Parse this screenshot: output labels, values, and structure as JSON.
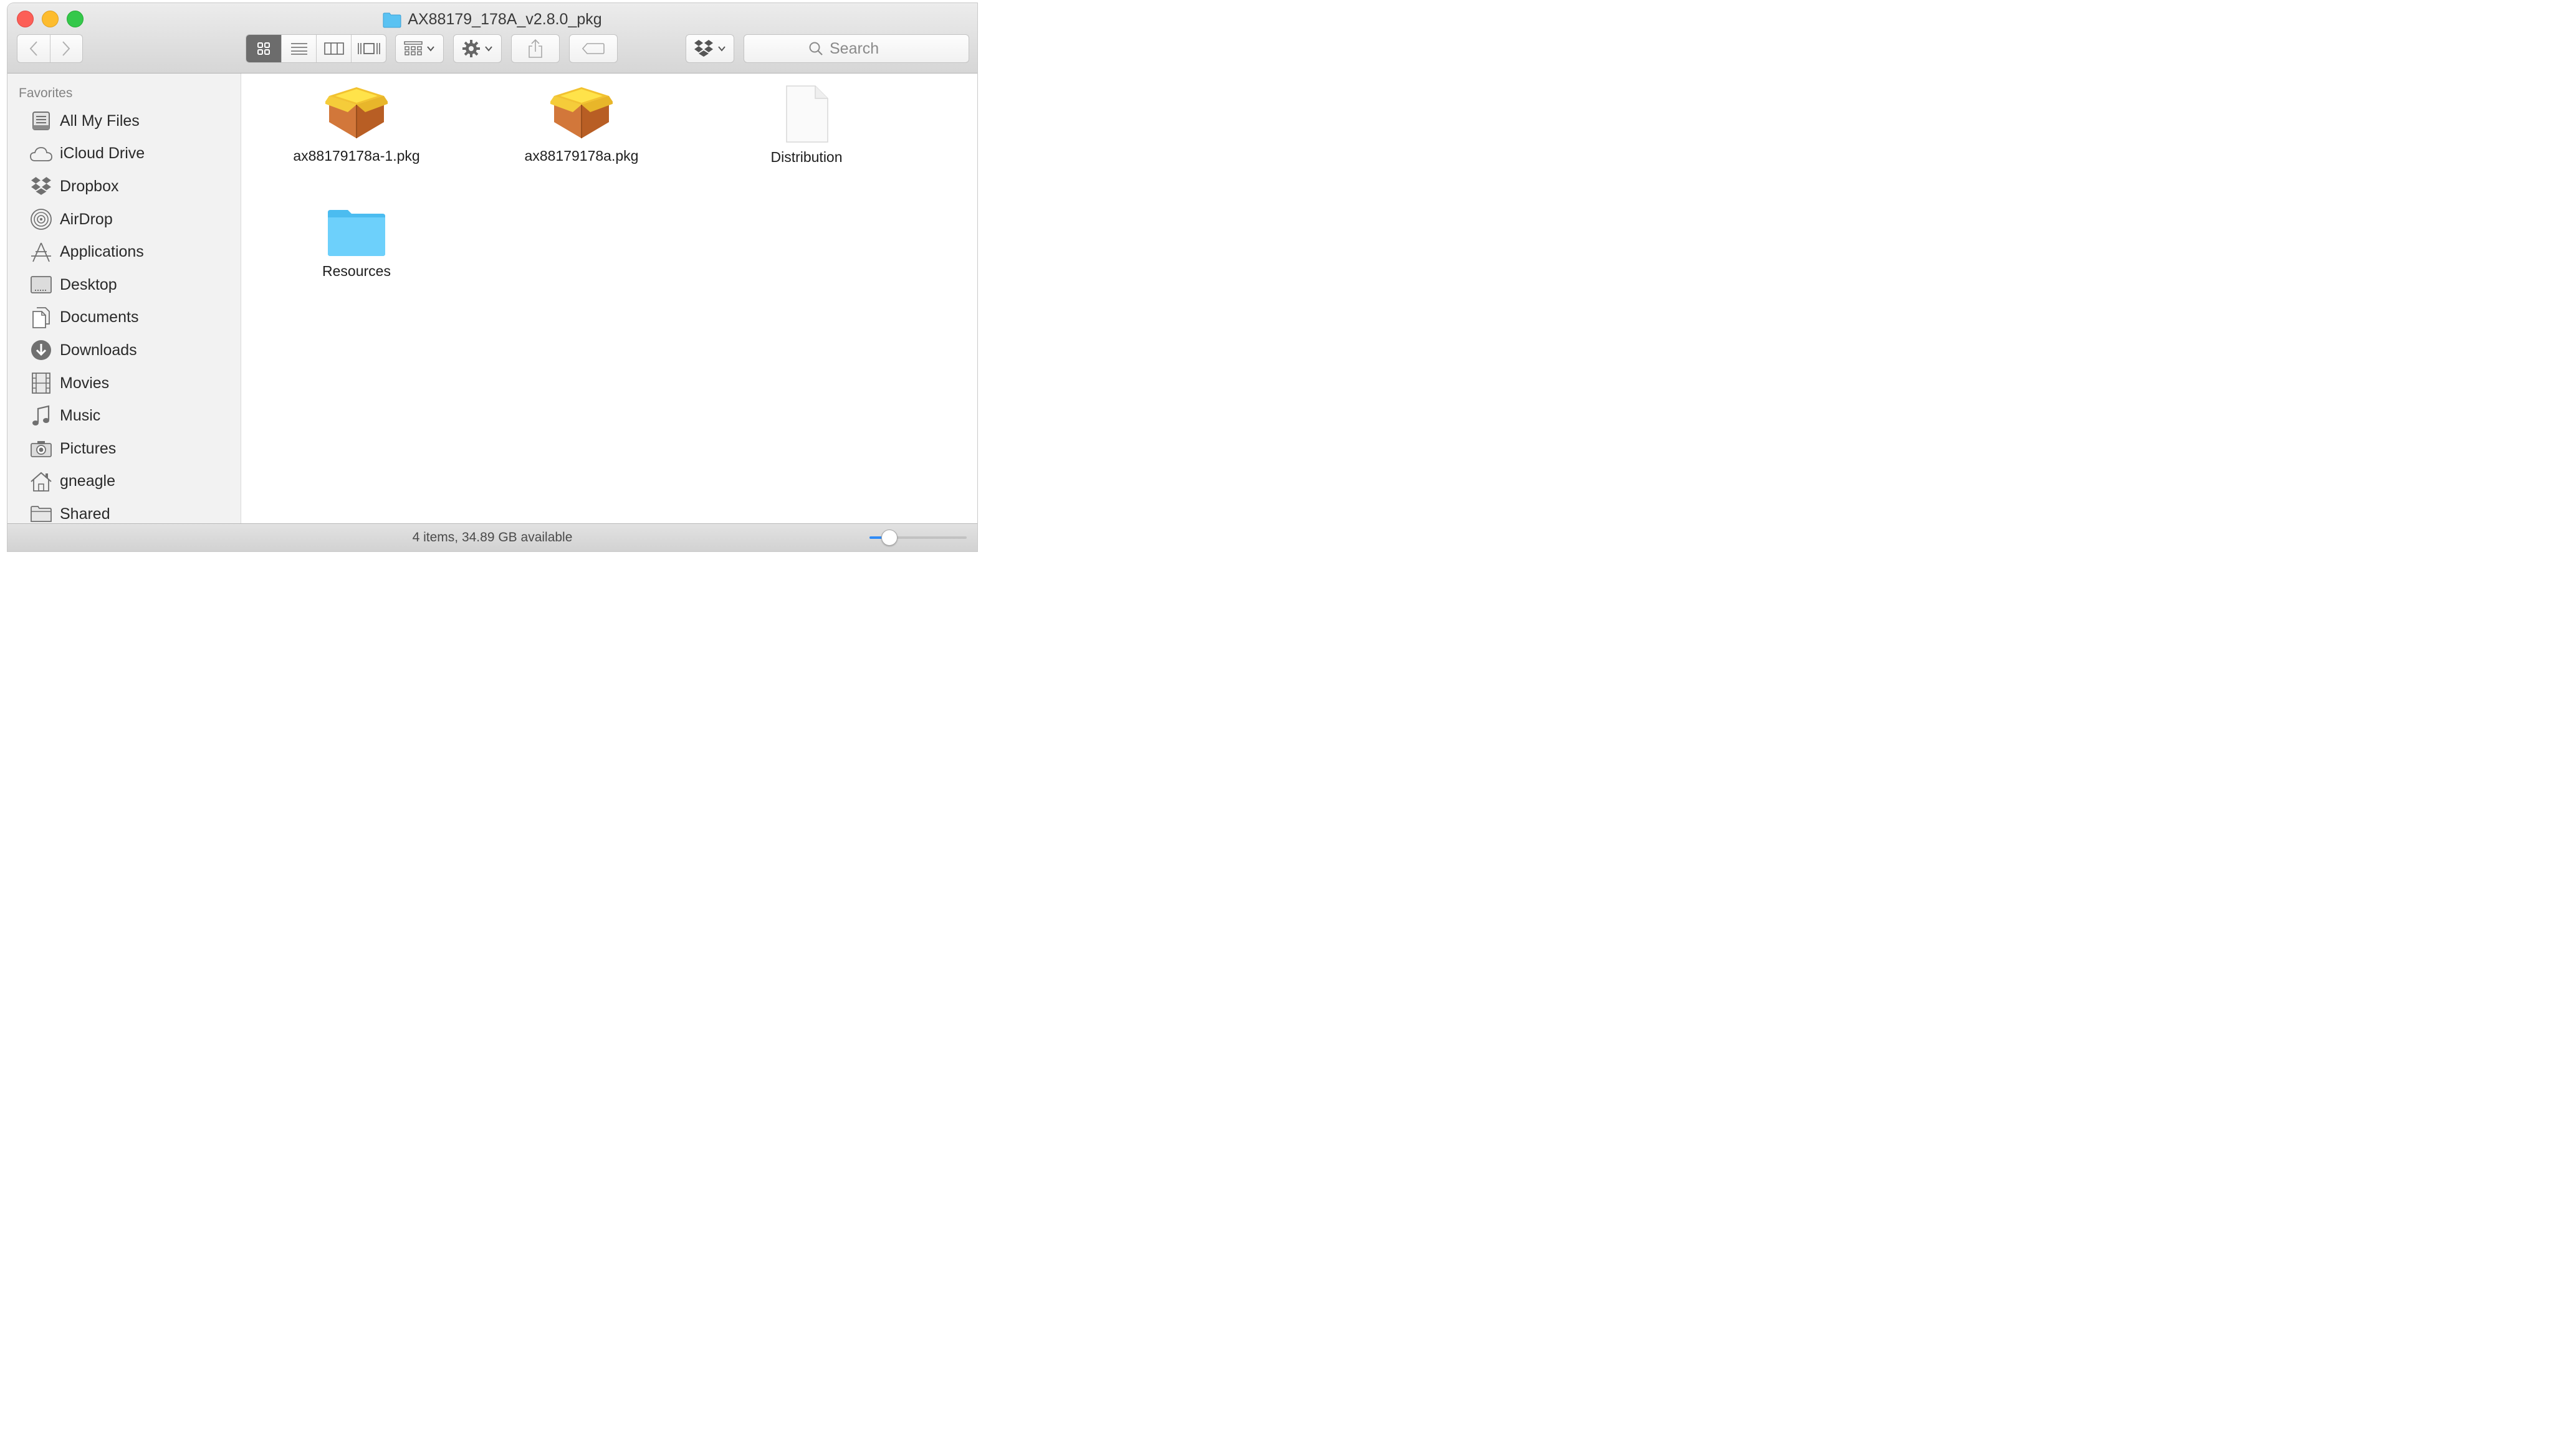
{
  "window": {
    "title": "AX88179_178A_v2.8.0_pkg"
  },
  "toolbar": {
    "back_icon": "chevron-left-icon",
    "forward_icon": "chevron-right-icon",
    "view_modes": [
      "icon-view-icon",
      "list-view-icon",
      "column-view-icon",
      "cover-flow-icon"
    ],
    "active_view": "icon-view",
    "search_placeholder": "Search"
  },
  "sidebar": {
    "heading": "Favorites",
    "items": [
      {
        "label": "All My Files",
        "icon": "all-my-files-icon"
      },
      {
        "label": "iCloud Drive",
        "icon": "cloud-icon"
      },
      {
        "label": "Dropbox",
        "icon": "dropbox-icon"
      },
      {
        "label": "AirDrop",
        "icon": "airdrop-icon"
      },
      {
        "label": "Applications",
        "icon": "applications-icon"
      },
      {
        "label": "Desktop",
        "icon": "desktop-icon"
      },
      {
        "label": "Documents",
        "icon": "documents-icon"
      },
      {
        "label": "Downloads",
        "icon": "downloads-icon"
      },
      {
        "label": "Movies",
        "icon": "movies-icon"
      },
      {
        "label": "Music",
        "icon": "music-icon"
      },
      {
        "label": "Pictures",
        "icon": "camera-icon"
      },
      {
        "label": "gneagle",
        "icon": "home-icon"
      },
      {
        "label": "Shared",
        "icon": "shared-folder-icon"
      }
    ]
  },
  "files": [
    {
      "name": "ax88179178a-1.pkg",
      "icon": "package-icon"
    },
    {
      "name": "ax88179178a.pkg",
      "icon": "package-icon"
    },
    {
      "name": "Distribution",
      "icon": "document-icon"
    },
    {
      "name": "Resources",
      "icon": "folder-icon"
    }
  ],
  "status": {
    "text": "4 items, 34.89 GB available",
    "icon_size_slider": 0.2
  },
  "colors": {
    "close": "#fc5f57",
    "minimize": "#fdbc2e",
    "maximize": "#34c84a",
    "folder_blue": "#4fc3f7",
    "slider_accent": "#2f8bf6"
  }
}
